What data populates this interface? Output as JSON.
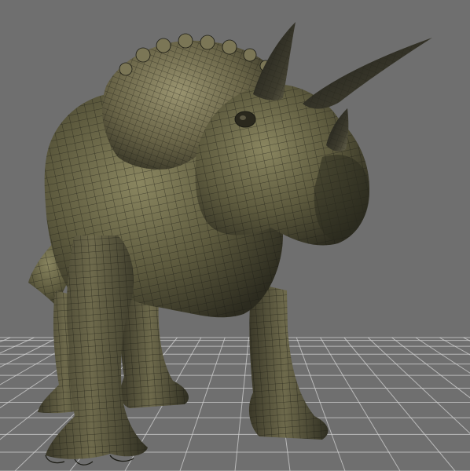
{
  "viewport": {
    "background": "#6f6f6f",
    "grid_color": "#d2d2d2",
    "model_color": "#58553a",
    "model_highlight": "#8a8660",
    "wire_color": "#1b1b14"
  },
  "model": {
    "icon": "triceratops-wireframe-model",
    "parts": [
      "body",
      "frill",
      "head",
      "brow-horn-left",
      "brow-horn-right",
      "nose-horn",
      "tail",
      "front-leg-left",
      "front-leg-right",
      "hind-leg-left",
      "hind-leg-right"
    ]
  }
}
